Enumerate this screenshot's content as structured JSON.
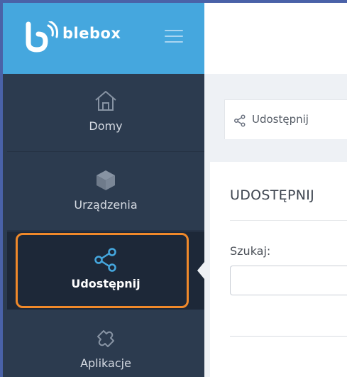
{
  "brand": {
    "logo_text": "blebox",
    "menu_icon": "hamburger-icon",
    "color": "#45a7de"
  },
  "sidebar": {
    "items": [
      {
        "label": "Domy",
        "icon": "home-icon"
      },
      {
        "label": "Urządzenia",
        "icon": "cube-icon"
      },
      {
        "label": "Udostępnij",
        "icon": "share-icon",
        "active": true
      },
      {
        "label": "Aplikacje",
        "icon": "puzzle-icon"
      }
    ],
    "highlight_color": "#f0892a"
  },
  "breadcrumb": {
    "icon": "share-icon",
    "label": "Udostępnij"
  },
  "card": {
    "title": "UDOSTĘPNIJ",
    "search_label": "Szukaj:",
    "search_value": ""
  }
}
